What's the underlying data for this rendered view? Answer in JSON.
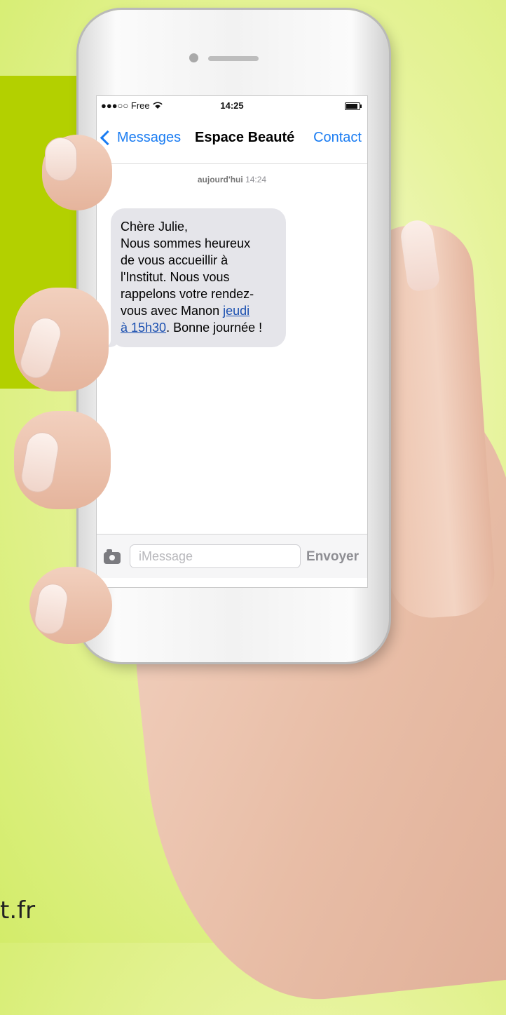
{
  "footer": {
    "text": "t.fr"
  },
  "status_bar": {
    "carrier": "●●●○○ Free",
    "wifi_glyph": "📶",
    "time": "14:25"
  },
  "nav": {
    "back_label": "Messages",
    "title": "Espace Beauté",
    "contact_label": "Contact"
  },
  "conversation": {
    "timestamp_day": "aujourd'hui",
    "timestamp_time": "14:24",
    "message_lines": [
      "Chère Julie,",
      "Nous sommes heureux",
      "de vous accueillir à",
      "l'Institut. Nous vous",
      "rappelons votre rendez-",
      "vous avec Manon "
    ],
    "link_part1": "jeudi",
    "link_part2": "à 15h30",
    "message_end": ". Bonne journée !"
  },
  "input_bar": {
    "placeholder": "iMessage",
    "value": "",
    "send_label": "Envoyer"
  },
  "colors": {
    "accent": "#1a7cf2",
    "panel_green": "#b3d000",
    "bubble_gray": "#e5e5ea"
  }
}
